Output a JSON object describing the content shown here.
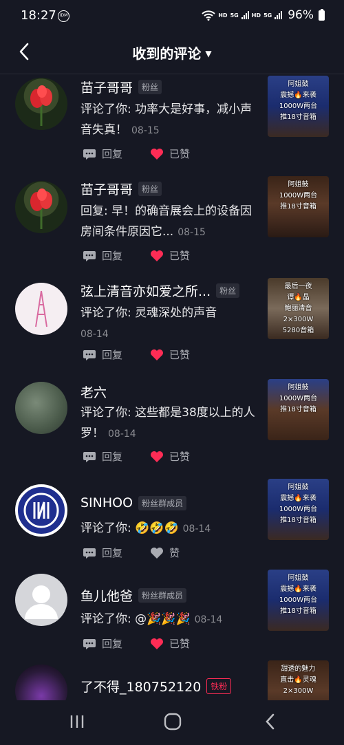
{
  "status": {
    "time": "18:27",
    "idm": "IDM",
    "hd1": "HD",
    "sig1": "5G",
    "hd2": "HD",
    "sig2": "5G",
    "battery": "96%"
  },
  "header": {
    "title": "收到的评论"
  },
  "items": [
    {
      "name": "苗子哥哥",
      "badge": "粉丝",
      "comment": "评论了你: 功率大是好事，减小声音失真！",
      "date": "08-15",
      "reply": "回复",
      "like": "已赞",
      "liked": true,
      "thumb": {
        "lines": [
          "阿姐鼓",
          "震撼🔥来袭",
          "1000W两台",
          "推18寸音箱"
        ]
      }
    },
    {
      "name": "苗子哥哥",
      "badge": "粉丝",
      "comment": "回复: 早！的确音展会上的设备因房间条件原因它...",
      "date": "08-15",
      "reply": "回复",
      "like": "已赞",
      "liked": true,
      "thumb": {
        "lines": [
          "阿姐鼓",
          "1000W两台",
          "推18寸音箱"
        ]
      }
    },
    {
      "name": "弦上清音亦如爱之所...",
      "badge": "粉丝",
      "comment": "评论了你: 灵魂深处的声音",
      "date": "08-14",
      "reply": "回复",
      "like": "已赞",
      "liked": true,
      "thumb": {
        "lines": [
          "最后一夜",
          "谭🔥晶",
          "鲍丽清音",
          "2×300W",
          "5280音箱"
        ]
      }
    },
    {
      "name": "老六",
      "badge": "",
      "comment": "评论了你: 这些都是38度以上的人罗！",
      "date": "08-14",
      "reply": "回复",
      "like": "已赞",
      "liked": true,
      "thumb": {
        "lines": [
          "阿姐鼓",
          "1000W两台",
          "推18寸音箱"
        ]
      }
    },
    {
      "name": "SINHOO",
      "badge": "粉丝群成员",
      "comment": "评论了你: 🤣🤣🤣",
      "date": "08-14",
      "reply": "回复",
      "like": "赞",
      "liked": false,
      "thumb": {
        "lines": [
          "阿姐鼓",
          "震撼🔥来袭",
          "1000W两台",
          "推18寸音箱"
        ]
      }
    },
    {
      "name": "鱼儿他爸",
      "badge": "粉丝群成员",
      "comment": "评论了你: @🎉🎉🎉",
      "date": "08-14",
      "reply": "回复",
      "like": "已赞",
      "liked": true,
      "thumb": {
        "lines": [
          "阿姐鼓",
          "震撼🔥来袭",
          "1000W两台",
          "推18寸音箱"
        ]
      }
    },
    {
      "name": "了不得_180752120",
      "badge": "铁粉",
      "comment": "",
      "date": "",
      "reply": "",
      "like": "",
      "liked": false,
      "thumb": {
        "lines": [
          "甜透的魅力",
          "直击🔥灵魂",
          "2×300W"
        ]
      }
    }
  ],
  "colors": {
    "bg": "#161823",
    "accent": "#fe2c55",
    "muted": "#a9abb2"
  }
}
